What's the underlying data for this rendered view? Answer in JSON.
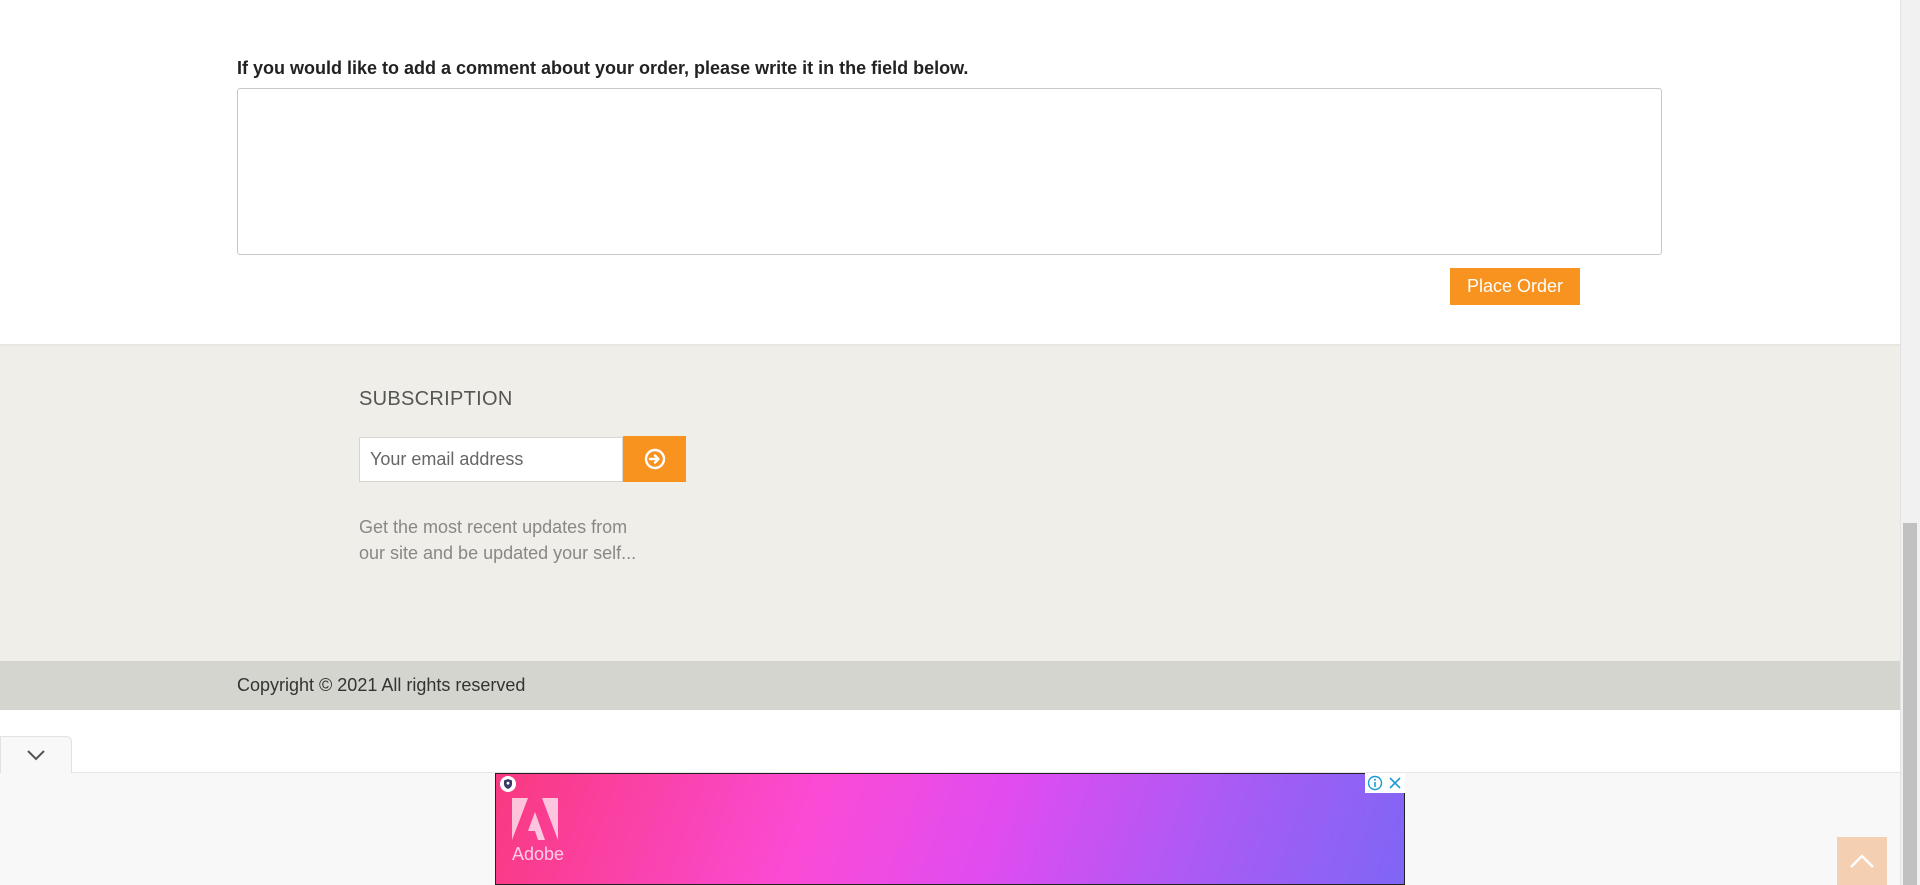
{
  "order": {
    "comment_label": "If you would like to add a comment about your order, please write it in the field below.",
    "comment_value": "",
    "place_order_label": "Place Order"
  },
  "subscription": {
    "title": "SUBSCRIPTION",
    "email_placeholder": "Your email address",
    "submit_icon": "arrow-circle-right-icon",
    "description": "Get the most recent updates from our site and be updated your self..."
  },
  "footer": {
    "copyright": "Copyright © 2021 All rights reserved"
  },
  "ad": {
    "brand": "Adobe",
    "info_icon": "info-icon",
    "close_icon": "close-icon",
    "collapse_icon": "chevron-down-icon"
  },
  "colors": {
    "accent": "#f7931e",
    "subscription_bg": "#efeee8",
    "copyright_bg": "#d5d5cf"
  }
}
